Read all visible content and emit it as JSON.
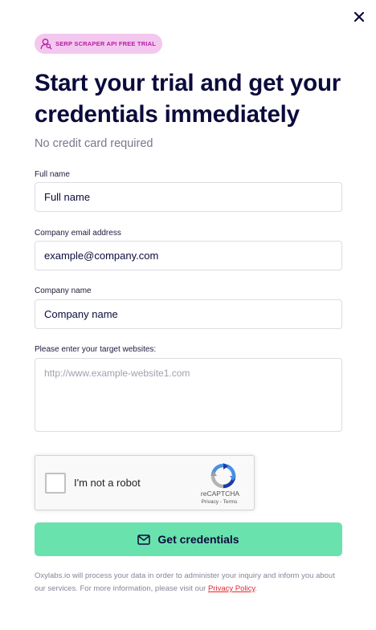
{
  "modal": {
    "close_icon": "close-icon"
  },
  "badge": {
    "icon": "user-search-icon",
    "text": "SERP SCRAPER API FREE TRIAL",
    "color": "#b61ca4",
    "background": "#f4c7ef"
  },
  "heading": {
    "title": "Start your trial and get your credentials immediately",
    "subtitle": "No credit card required"
  },
  "form": {
    "full_name": {
      "label": "Full name",
      "placeholder": "Full name"
    },
    "email": {
      "label": "Company email address",
      "placeholder": "example@company.com"
    },
    "company": {
      "label": "Company name",
      "placeholder": "Company name"
    },
    "websites": {
      "label": "Please enter your target websites:",
      "placeholder": "http://www.example-website1.com"
    }
  },
  "recaptcha": {
    "label": "I'm not a robot",
    "brand": "reCAPTCHA",
    "links": "Privacy - Terms"
  },
  "submit": {
    "icon": "mail-icon",
    "label": "Get credentials",
    "color": "#6ae2ae"
  },
  "disclaimer": {
    "text": "Oxylabs.io will process your data in order to administer your inquiry and inform you about our services. For more information, please visit our ",
    "link_text": "Privacy Policy",
    "trailing": "."
  }
}
